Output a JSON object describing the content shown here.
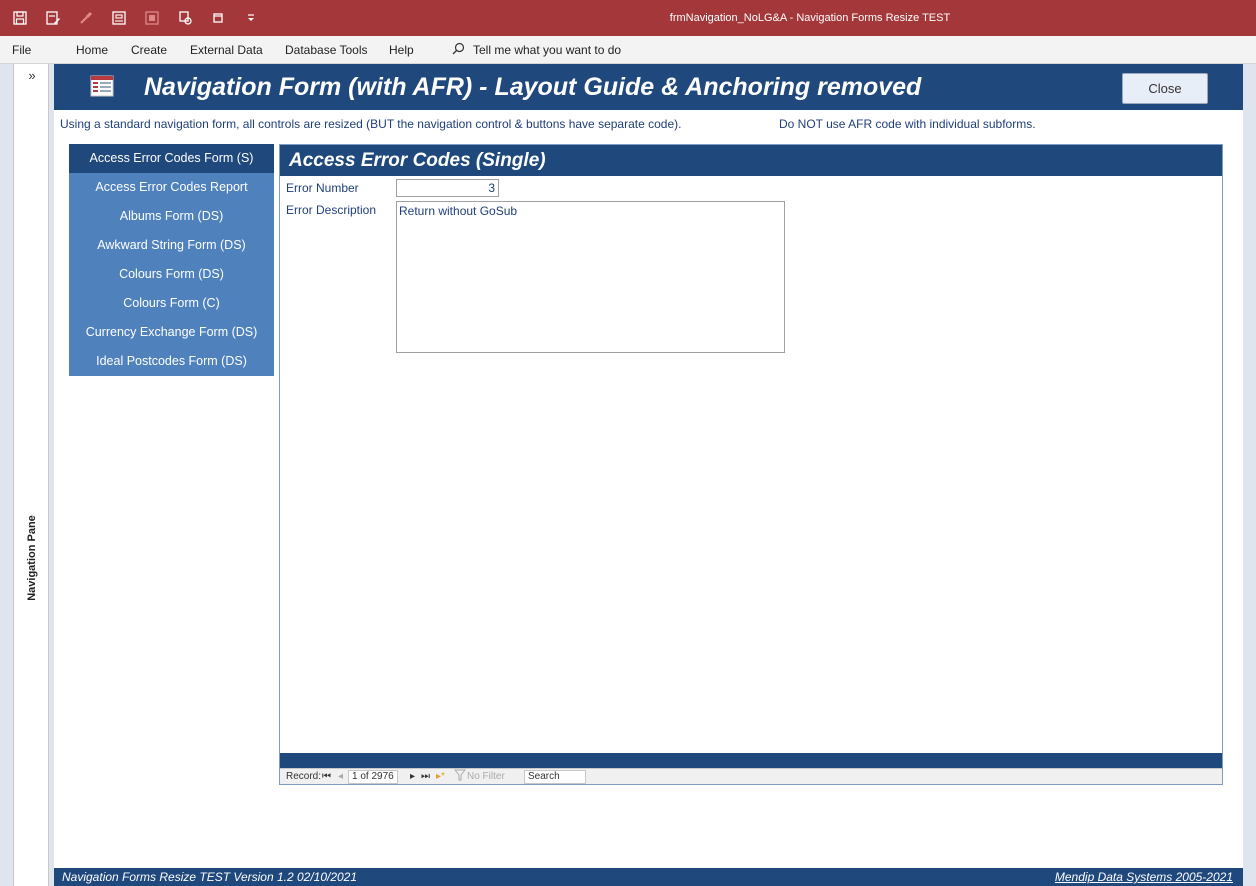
{
  "window": {
    "title": "frmNavigation_NoLG&A  -  Navigation Forms Resize TEST"
  },
  "quick_access": [
    {
      "name": "save-icon"
    },
    {
      "name": "form-design-icon"
    },
    {
      "name": "brush-icon"
    },
    {
      "name": "report-icon"
    },
    {
      "name": "query-icon"
    },
    {
      "name": "macro-icon"
    },
    {
      "name": "window-icon"
    },
    {
      "name": "customize-dropdown-icon"
    }
  ],
  "ribbon": {
    "tabs": [
      "File",
      "Home",
      "Create",
      "External Data",
      "Database Tools",
      "Help"
    ],
    "tell_me": "Tell me what you want to do"
  },
  "nav_pane": {
    "chevron": "»",
    "label": "Navigation Pane"
  },
  "form": {
    "title": "Navigation Form (with AFR) - Layout Guide & Anchoring removed",
    "close_label": "Close",
    "info_a": "Using a standard navigation form, all controls are resized (BUT the navigation control & buttons have separate code).",
    "info_b": "Do NOT use AFR code with individual subforms.",
    "nav_buttons": [
      "Access Error Codes Form (S)",
      "Access Error Codes Report",
      "Albums Form (DS)",
      "Awkward String Form (DS)",
      "Colours Form (DS)",
      "Colours Form (C)",
      "Currency Exchange Form (DS)",
      "Ideal Postcodes Form (DS)"
    ],
    "active_nav_index": 0
  },
  "subform": {
    "title": "Access Error Codes (Single)",
    "error_number_label": "Error Number",
    "error_number_value": "3",
    "error_description_label": "Error Description",
    "error_description_value": "Return without GoSub"
  },
  "record_nav": {
    "record_label": "Record:",
    "first": "⏮",
    "prev": "◂",
    "position": "1 of 2976",
    "next": "▸",
    "last": "⏭",
    "new": "▸*",
    "filter_label": "No Filter",
    "search_label": "Search"
  },
  "footer": {
    "left": "Navigation Forms Resize TEST   Version 1.2   02/10/2021",
    "right": "Mendip Data Systems 2005-2021"
  },
  "colors": {
    "titlebar": "#a4373a",
    "header": "#1f487c",
    "nav_button": "#4f81bd",
    "nav_button_active": "#1f487c"
  }
}
